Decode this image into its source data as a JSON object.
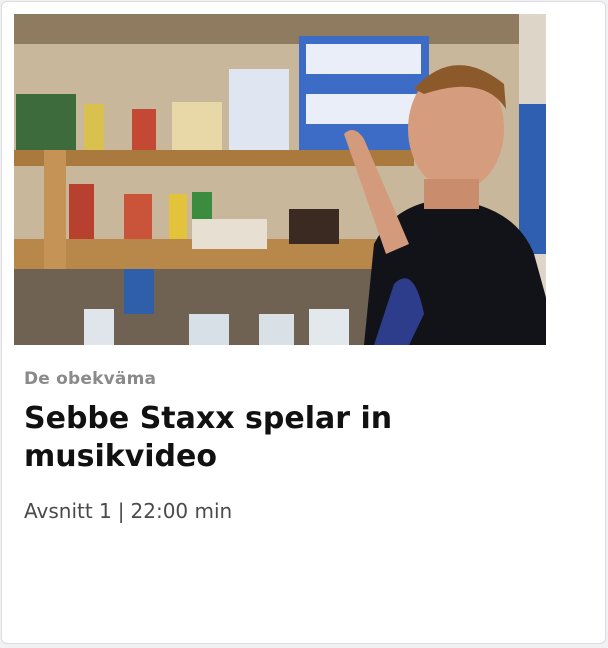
{
  "card": {
    "series": "De obekväma",
    "title": "Sebbe Staxx spelar in musikvideo",
    "episode": "Avsnitt 1",
    "separator": "|",
    "duration": "22:00 min"
  },
  "colors": {
    "series": "#8a8a8a",
    "title": "#111111",
    "meta": "#4a4a4a"
  }
}
